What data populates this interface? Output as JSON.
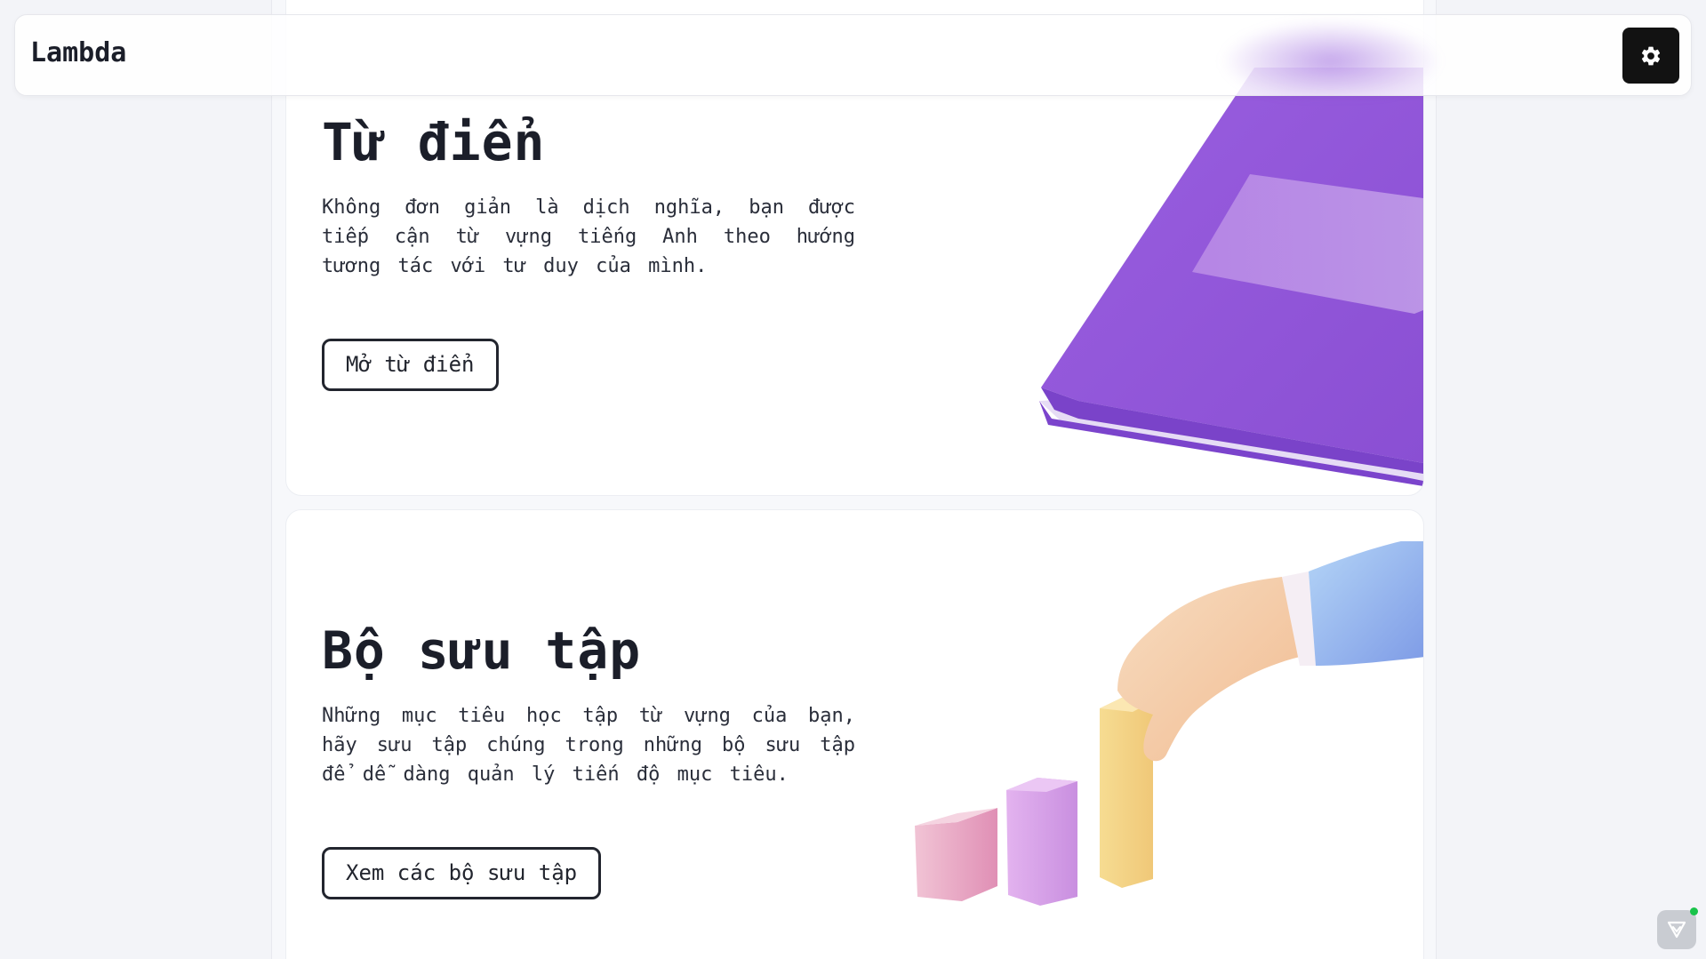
{
  "header": {
    "brand": "Lambda",
    "settings_icon": "gear-icon"
  },
  "cards": [
    {
      "title": "Từ điển",
      "description": "Không đơn giản là dịch nghĩa, bạn được tiếp cận từ vựng tiếng Anh theo hướng tương tác với tư duy của mình.",
      "button_label": "Mở từ điển",
      "illustration": "purple-book-illustration"
    },
    {
      "title": "Bộ sưu tập",
      "description": "Những mục tiêu học tập từ vựng của bạn, hãy sưu tập chúng trong những bộ sưu tập để dễ dàng quản lý tiến độ mục tiêu.",
      "button_label": "Xem các bộ sưu tập",
      "illustration": "hand-stacking-bars-illustration"
    }
  ],
  "widget": {
    "icon": "assistant-icon",
    "status_color": "#19c34a"
  },
  "colors": {
    "accent_dark": "#121212",
    "book_purple": "#8f55d6"
  }
}
